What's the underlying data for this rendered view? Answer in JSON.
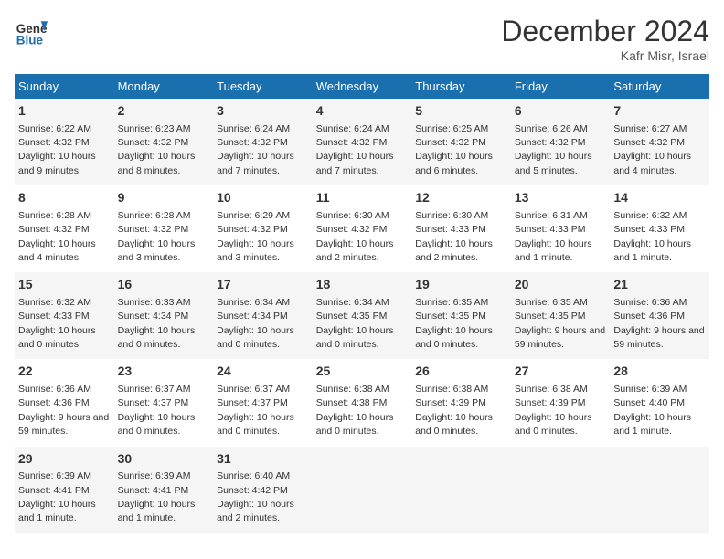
{
  "header": {
    "logo_line1": "General",
    "logo_line2": "Blue",
    "month": "December 2024",
    "location": "Kafr Misr, Israel"
  },
  "weekdays": [
    "Sunday",
    "Monday",
    "Tuesday",
    "Wednesday",
    "Thursday",
    "Friday",
    "Saturday"
  ],
  "weeks": [
    [
      {
        "day": "1",
        "sunrise": "6:22 AM",
        "sunset": "4:32 PM",
        "daylight": "10 hours and 9 minutes."
      },
      {
        "day": "2",
        "sunrise": "6:23 AM",
        "sunset": "4:32 PM",
        "daylight": "10 hours and 8 minutes."
      },
      {
        "day": "3",
        "sunrise": "6:24 AM",
        "sunset": "4:32 PM",
        "daylight": "10 hours and 7 minutes."
      },
      {
        "day": "4",
        "sunrise": "6:24 AM",
        "sunset": "4:32 PM",
        "daylight": "10 hours and 7 minutes."
      },
      {
        "day": "5",
        "sunrise": "6:25 AM",
        "sunset": "4:32 PM",
        "daylight": "10 hours and 6 minutes."
      },
      {
        "day": "6",
        "sunrise": "6:26 AM",
        "sunset": "4:32 PM",
        "daylight": "10 hours and 5 minutes."
      },
      {
        "day": "7",
        "sunrise": "6:27 AM",
        "sunset": "4:32 PM",
        "daylight": "10 hours and 4 minutes."
      }
    ],
    [
      {
        "day": "8",
        "sunrise": "6:28 AM",
        "sunset": "4:32 PM",
        "daylight": "10 hours and 4 minutes."
      },
      {
        "day": "9",
        "sunrise": "6:28 AM",
        "sunset": "4:32 PM",
        "daylight": "10 hours and 3 minutes."
      },
      {
        "day": "10",
        "sunrise": "6:29 AM",
        "sunset": "4:32 PM",
        "daylight": "10 hours and 3 minutes."
      },
      {
        "day": "11",
        "sunrise": "6:30 AM",
        "sunset": "4:32 PM",
        "daylight": "10 hours and 2 minutes."
      },
      {
        "day": "12",
        "sunrise": "6:30 AM",
        "sunset": "4:33 PM",
        "daylight": "10 hours and 2 minutes."
      },
      {
        "day": "13",
        "sunrise": "6:31 AM",
        "sunset": "4:33 PM",
        "daylight": "10 hours and 1 minute."
      },
      {
        "day": "14",
        "sunrise": "6:32 AM",
        "sunset": "4:33 PM",
        "daylight": "10 hours and 1 minute."
      }
    ],
    [
      {
        "day": "15",
        "sunrise": "6:32 AM",
        "sunset": "4:33 PM",
        "daylight": "10 hours and 0 minutes."
      },
      {
        "day": "16",
        "sunrise": "6:33 AM",
        "sunset": "4:34 PM",
        "daylight": "10 hours and 0 minutes."
      },
      {
        "day": "17",
        "sunrise": "6:34 AM",
        "sunset": "4:34 PM",
        "daylight": "10 hours and 0 minutes."
      },
      {
        "day": "18",
        "sunrise": "6:34 AM",
        "sunset": "4:35 PM",
        "daylight": "10 hours and 0 minutes."
      },
      {
        "day": "19",
        "sunrise": "6:35 AM",
        "sunset": "4:35 PM",
        "daylight": "10 hours and 0 minutes."
      },
      {
        "day": "20",
        "sunrise": "6:35 AM",
        "sunset": "4:35 PM",
        "daylight": "9 hours and 59 minutes."
      },
      {
        "day": "21",
        "sunrise": "6:36 AM",
        "sunset": "4:36 PM",
        "daylight": "9 hours and 59 minutes."
      }
    ],
    [
      {
        "day": "22",
        "sunrise": "6:36 AM",
        "sunset": "4:36 PM",
        "daylight": "9 hours and 59 minutes."
      },
      {
        "day": "23",
        "sunrise": "6:37 AM",
        "sunset": "4:37 PM",
        "daylight": "10 hours and 0 minutes."
      },
      {
        "day": "24",
        "sunrise": "6:37 AM",
        "sunset": "4:37 PM",
        "daylight": "10 hours and 0 minutes."
      },
      {
        "day": "25",
        "sunrise": "6:38 AM",
        "sunset": "4:38 PM",
        "daylight": "10 hours and 0 minutes."
      },
      {
        "day": "26",
        "sunrise": "6:38 AM",
        "sunset": "4:39 PM",
        "daylight": "10 hours and 0 minutes."
      },
      {
        "day": "27",
        "sunrise": "6:38 AM",
        "sunset": "4:39 PM",
        "daylight": "10 hours and 0 minutes."
      },
      {
        "day": "28",
        "sunrise": "6:39 AM",
        "sunset": "4:40 PM",
        "daylight": "10 hours and 1 minute."
      }
    ],
    [
      {
        "day": "29",
        "sunrise": "6:39 AM",
        "sunset": "4:41 PM",
        "daylight": "10 hours and 1 minute."
      },
      {
        "day": "30",
        "sunrise": "6:39 AM",
        "sunset": "4:41 PM",
        "daylight": "10 hours and 1 minute."
      },
      {
        "day": "31",
        "sunrise": "6:40 AM",
        "sunset": "4:42 PM",
        "daylight": "10 hours and 2 minutes."
      },
      null,
      null,
      null,
      null
    ]
  ]
}
